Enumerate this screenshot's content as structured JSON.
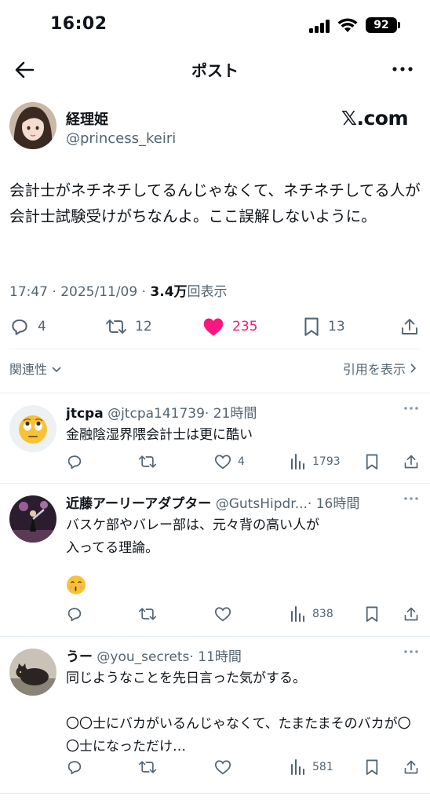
{
  "status": {
    "time": "16:02",
    "battery": "92"
  },
  "nav": {
    "title": "ポスト"
  },
  "post": {
    "author_name": "経理姫",
    "author_handle": "@princess_keiri",
    "brand": "𝕏.com",
    "text": "会計士がネチネチしてるんじゃなくて、ネチネチしてる人が会計士試験受けがちなんよ。ここ誤解しないように。",
    "time": "17:47 · 2025/11/09 · ",
    "views_count": "3.4万",
    "views_label": "回表示",
    "replies": "4",
    "reposts": "12",
    "likes": "235",
    "bookmarks": "13",
    "relevance_label": "関連性",
    "quotes_label": "引用を表示"
  },
  "replies": [
    {
      "name": "jtcpa",
      "handle": "@jtcpa141739",
      "time": "· 21時間",
      "text": "金融陰湿界隈会計士は更に酷い",
      "replies": "",
      "reposts": "",
      "likes": "4",
      "views": "1793",
      "avatar": "face-rolling-eyes-emoji"
    },
    {
      "name": "近藤アーリーアダプター",
      "handle": "@GutsHipdr...",
      "time": "· 16時間",
      "text": "バスケ部やバレー部は、元々背の高い人が\n入ってる理論。",
      "emoji": "😙",
      "replies": "",
      "reposts": "",
      "likes": "",
      "views": "838",
      "avatar": "photo"
    },
    {
      "name": "うー",
      "handle": "@you_secrets",
      "time": "· 11時間",
      "text": "同じようなことを先日言った気がする。\n\n〇〇士にバカがいるんじゃなくて、たまたまそのバカが〇〇士になっただけ…",
      "replies": "",
      "reposts": "",
      "likes": "",
      "views": "581",
      "avatar": "photo"
    }
  ],
  "colors": {
    "text": "#0f1419",
    "muted": "#536471",
    "like": "#f91880",
    "divider": "#eff3f4"
  }
}
